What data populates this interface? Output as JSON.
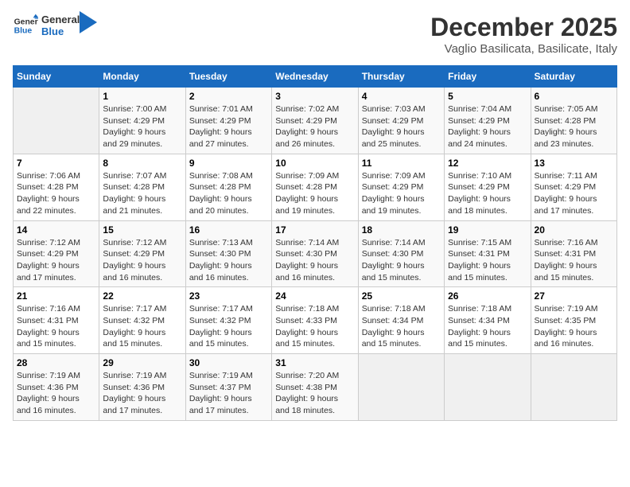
{
  "header": {
    "logo_line1": "General",
    "logo_line2": "Blue",
    "month": "December 2025",
    "location": "Vaglio Basilicata, Basilicate, Italy"
  },
  "days_of_week": [
    "Sunday",
    "Monday",
    "Tuesday",
    "Wednesday",
    "Thursday",
    "Friday",
    "Saturday"
  ],
  "weeks": [
    [
      {
        "day": "",
        "info": ""
      },
      {
        "day": "1",
        "info": "Sunrise: 7:00 AM\nSunset: 4:29 PM\nDaylight: 9 hours\nand 29 minutes."
      },
      {
        "day": "2",
        "info": "Sunrise: 7:01 AM\nSunset: 4:29 PM\nDaylight: 9 hours\nand 27 minutes."
      },
      {
        "day": "3",
        "info": "Sunrise: 7:02 AM\nSunset: 4:29 PM\nDaylight: 9 hours\nand 26 minutes."
      },
      {
        "day": "4",
        "info": "Sunrise: 7:03 AM\nSunset: 4:29 PM\nDaylight: 9 hours\nand 25 minutes."
      },
      {
        "day": "5",
        "info": "Sunrise: 7:04 AM\nSunset: 4:29 PM\nDaylight: 9 hours\nand 24 minutes."
      },
      {
        "day": "6",
        "info": "Sunrise: 7:05 AM\nSunset: 4:28 PM\nDaylight: 9 hours\nand 23 minutes."
      }
    ],
    [
      {
        "day": "7",
        "info": "Sunrise: 7:06 AM\nSunset: 4:28 PM\nDaylight: 9 hours\nand 22 minutes."
      },
      {
        "day": "8",
        "info": "Sunrise: 7:07 AM\nSunset: 4:28 PM\nDaylight: 9 hours\nand 21 minutes."
      },
      {
        "day": "9",
        "info": "Sunrise: 7:08 AM\nSunset: 4:28 PM\nDaylight: 9 hours\nand 20 minutes."
      },
      {
        "day": "10",
        "info": "Sunrise: 7:09 AM\nSunset: 4:28 PM\nDaylight: 9 hours\nand 19 minutes."
      },
      {
        "day": "11",
        "info": "Sunrise: 7:09 AM\nSunset: 4:29 PM\nDaylight: 9 hours\nand 19 minutes."
      },
      {
        "day": "12",
        "info": "Sunrise: 7:10 AM\nSunset: 4:29 PM\nDaylight: 9 hours\nand 18 minutes."
      },
      {
        "day": "13",
        "info": "Sunrise: 7:11 AM\nSunset: 4:29 PM\nDaylight: 9 hours\nand 17 minutes."
      }
    ],
    [
      {
        "day": "14",
        "info": "Sunrise: 7:12 AM\nSunset: 4:29 PM\nDaylight: 9 hours\nand 17 minutes."
      },
      {
        "day": "15",
        "info": "Sunrise: 7:12 AM\nSunset: 4:29 PM\nDaylight: 9 hours\nand 16 minutes."
      },
      {
        "day": "16",
        "info": "Sunrise: 7:13 AM\nSunset: 4:30 PM\nDaylight: 9 hours\nand 16 minutes."
      },
      {
        "day": "17",
        "info": "Sunrise: 7:14 AM\nSunset: 4:30 PM\nDaylight: 9 hours\nand 16 minutes."
      },
      {
        "day": "18",
        "info": "Sunrise: 7:14 AM\nSunset: 4:30 PM\nDaylight: 9 hours\nand 15 minutes."
      },
      {
        "day": "19",
        "info": "Sunrise: 7:15 AM\nSunset: 4:31 PM\nDaylight: 9 hours\nand 15 minutes."
      },
      {
        "day": "20",
        "info": "Sunrise: 7:16 AM\nSunset: 4:31 PM\nDaylight: 9 hours\nand 15 minutes."
      }
    ],
    [
      {
        "day": "21",
        "info": "Sunrise: 7:16 AM\nSunset: 4:31 PM\nDaylight: 9 hours\nand 15 minutes."
      },
      {
        "day": "22",
        "info": "Sunrise: 7:17 AM\nSunset: 4:32 PM\nDaylight: 9 hours\nand 15 minutes."
      },
      {
        "day": "23",
        "info": "Sunrise: 7:17 AM\nSunset: 4:32 PM\nDaylight: 9 hours\nand 15 minutes."
      },
      {
        "day": "24",
        "info": "Sunrise: 7:18 AM\nSunset: 4:33 PM\nDaylight: 9 hours\nand 15 minutes."
      },
      {
        "day": "25",
        "info": "Sunrise: 7:18 AM\nSunset: 4:34 PM\nDaylight: 9 hours\nand 15 minutes."
      },
      {
        "day": "26",
        "info": "Sunrise: 7:18 AM\nSunset: 4:34 PM\nDaylight: 9 hours\nand 15 minutes."
      },
      {
        "day": "27",
        "info": "Sunrise: 7:19 AM\nSunset: 4:35 PM\nDaylight: 9 hours\nand 16 minutes."
      }
    ],
    [
      {
        "day": "28",
        "info": "Sunrise: 7:19 AM\nSunset: 4:36 PM\nDaylight: 9 hours\nand 16 minutes."
      },
      {
        "day": "29",
        "info": "Sunrise: 7:19 AM\nSunset: 4:36 PM\nDaylight: 9 hours\nand 17 minutes."
      },
      {
        "day": "30",
        "info": "Sunrise: 7:19 AM\nSunset: 4:37 PM\nDaylight: 9 hours\nand 17 minutes."
      },
      {
        "day": "31",
        "info": "Sunrise: 7:20 AM\nSunset: 4:38 PM\nDaylight: 9 hours\nand 18 minutes."
      },
      {
        "day": "",
        "info": ""
      },
      {
        "day": "",
        "info": ""
      },
      {
        "day": "",
        "info": ""
      }
    ]
  ]
}
